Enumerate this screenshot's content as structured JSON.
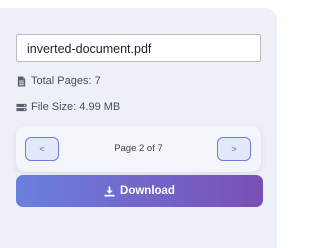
{
  "file": {
    "name": "inverted-document.pdf"
  },
  "info": {
    "pages_label": "Total Pages: 7",
    "size_label": "File Size: 4.99 MB"
  },
  "pager": {
    "prev_label": "<",
    "next_label": ">",
    "indicator": "Page 2 of 7",
    "current_page": 2,
    "total_pages": 7
  },
  "download": {
    "label": "Download"
  },
  "icons": {
    "file": "file-icon",
    "drive": "hard-drive-icon",
    "download": "download-icon"
  },
  "colors": {
    "accent_start": "#6a7fde",
    "accent_end": "#7a4fb5",
    "pager_button_border": "#6a7ed8"
  }
}
